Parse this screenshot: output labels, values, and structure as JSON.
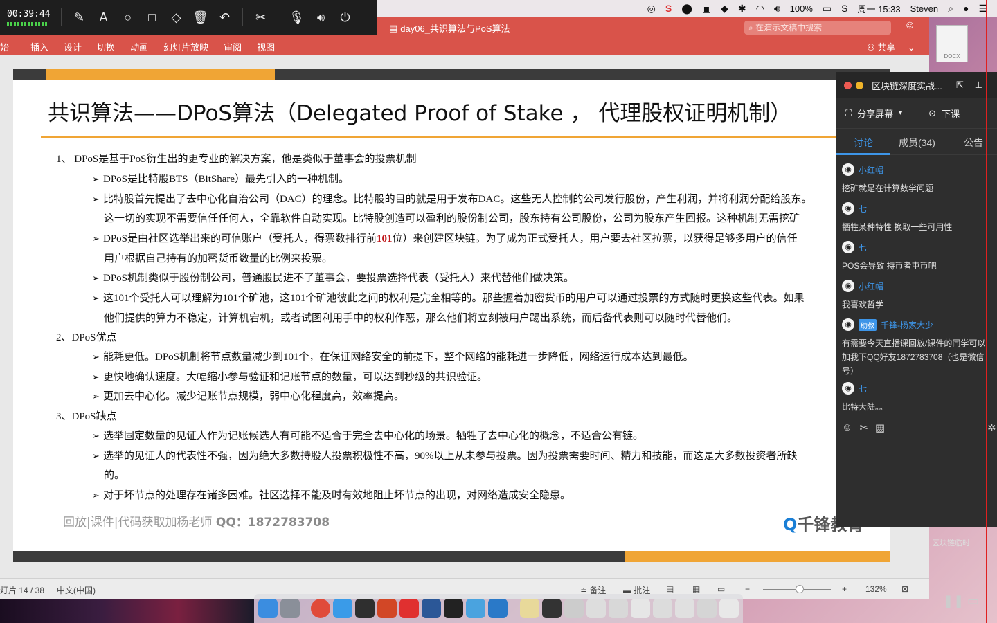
{
  "recorder": {
    "time": "00:39:44",
    "tools": [
      "pen-icon",
      "text-icon",
      "circle-icon",
      "rect-icon",
      "eraser-icon",
      "trash-icon",
      "undo-icon",
      "cut-icon",
      "mic-icon",
      "speaker-icon",
      "power-icon"
    ]
  },
  "menubar": {
    "battery": "100%",
    "datetime": "周一 15:33",
    "user": "Steven"
  },
  "ppt": {
    "doc_title": "day06_共识算法与PoS算法",
    "search_placeholder": "在演示文稿中搜索",
    "ribbon_tabs": [
      "插入",
      "设计",
      "切换",
      "动画",
      "幻灯片放映",
      "审阅",
      "视图"
    ],
    "ribbon_first_partial": "始",
    "share_label": "共享",
    "status": {
      "slide": "灯片 14 / 38",
      "lang": "中文(中国)",
      "notes": "备注",
      "comments": "批注",
      "zoom": "132%"
    }
  },
  "slide": {
    "title": "共识算法——DPoS算法（Delegated Proof of Stake ， 代理股权证明机制）",
    "lines": [
      {
        "kind": "num",
        "text": "1、 DPoS是基于PoS衍生出的更专业的解决方案，他是类似于董事会的投票机制"
      },
      {
        "kind": "sub",
        "text": "DPoS是比特股BTS（BitShare）最先引入的一种机制。"
      },
      {
        "kind": "sub",
        "text": "比特股首先提出了去中心化自治公司（DAC）的理念。比特股的目的就是用于发布DAC。这些无人控制的公司发行股份，产生利润，并将利润分配给股东。"
      },
      {
        "kind": "cont",
        "text": "这一切的实现不需要信任任何人，全靠软件自动实现。比特股创造可以盈利的股份制公司，股东持有公司股份，公司为股东产生回报。这种机制无需挖矿"
      },
      {
        "kind": "sub-red",
        "pre": "DPoS是由社区选举出来的可信账户（受托人，得票数排行前",
        "red": "101",
        "post": "位）来创建区块链。为了成为正式受托人，用户要去社区拉票，以获得足够多用户的信任"
      },
      {
        "kind": "cont",
        "text": "用户根据自己持有的加密货币数量的比例来投票。"
      },
      {
        "kind": "sub",
        "text": "DPoS机制类似于股份制公司，普通股民进不了董事会，要投票选择代表（受托人）来代替他们做决策。"
      },
      {
        "kind": "sub",
        "text": "这101个受托人可以理解为101个矿池，这101个矿池彼此之间的权利是完全相等的。那些握着加密货币的用户可以通过投票的方式随时更换这些代表。如果"
      },
      {
        "kind": "cont",
        "text": "他们提供的算力不稳定，计算机宕机，或者试图利用手中的权利作恶，那么他们将立刻被用户踢出系统，而后备代表则可以随时代替他们。"
      },
      {
        "kind": "num",
        "text": "2、DPoS优点"
      },
      {
        "kind": "sub",
        "text": "能耗更低。DPoS机制将节点数量减少到101个，在保证网络安全的前提下，整个网络的能耗进一步降低，网络运行成本达到最低。"
      },
      {
        "kind": "sub",
        "text": "更快地确认速度。大幅缩小参与验证和记账节点的数量，可以达到秒级的共识验证。"
      },
      {
        "kind": "sub",
        "text": "更加去中心化。减少记账节点规模，弱中心化程度高，效率提高。"
      },
      {
        "kind": "num",
        "text": "3、DPoS缺点"
      },
      {
        "kind": "sub",
        "text": "选举固定数量的见证人作为记账候选人有可能不适合于完全去中心化的场景。牺牲了去中心化的概念，不适合公有链。"
      },
      {
        "kind": "sub",
        "text": "选举的见证人的代表性不强，因为绝大多数持股人投票积极性不高，90%以上从未参与投票。因为投票需要时间、精力和技能，而这是大多数投资者所缺"
      },
      {
        "kind": "cont",
        "text": "的。"
      },
      {
        "kind": "sub",
        "text": "对于坏节点的处理存在诸多困难。社区选择不能及时有效地阻止坏节点的出现，对网络造成安全隐患。"
      }
    ],
    "footer_text": "回放|课件|代码获取加杨老师",
    "footer_qq": "QQ：1872783708",
    "logo": "千锋教育"
  },
  "chat": {
    "window_title": "区块链深度实战...",
    "share_screen": "分享屏幕",
    "end_class": "下课",
    "tabs": [
      "讨论",
      "成员(34)",
      "公告"
    ],
    "messages": [
      {
        "user": "小红帽",
        "badge": "",
        "text": "挖矿就是在计算数学问题"
      },
      {
        "user": "七",
        "badge": "",
        "text": "牺牲某种特性 换取一些可用性"
      },
      {
        "user": "七",
        "badge": "",
        "text": "POS会导致 持币者屯币吧"
      },
      {
        "user": "小红帽",
        "badge": "",
        "text": "我喜欢哲学"
      },
      {
        "user": "千锋-杨家大少",
        "badge": "助教",
        "text": "有需要今天直播课回放/课件的同学可以加我下QQ好友1872783708（也是微信号）"
      },
      {
        "user": "七",
        "badge": "",
        "text": "比特大陆。。"
      }
    ]
  },
  "desktop": {
    "docx_label": "DOCX",
    "file_label": "区块链临时"
  },
  "colors": {
    "ppt_red": "#d9534a",
    "accent_orange": "#f0a535",
    "chat_blue": "#3d95e8"
  }
}
